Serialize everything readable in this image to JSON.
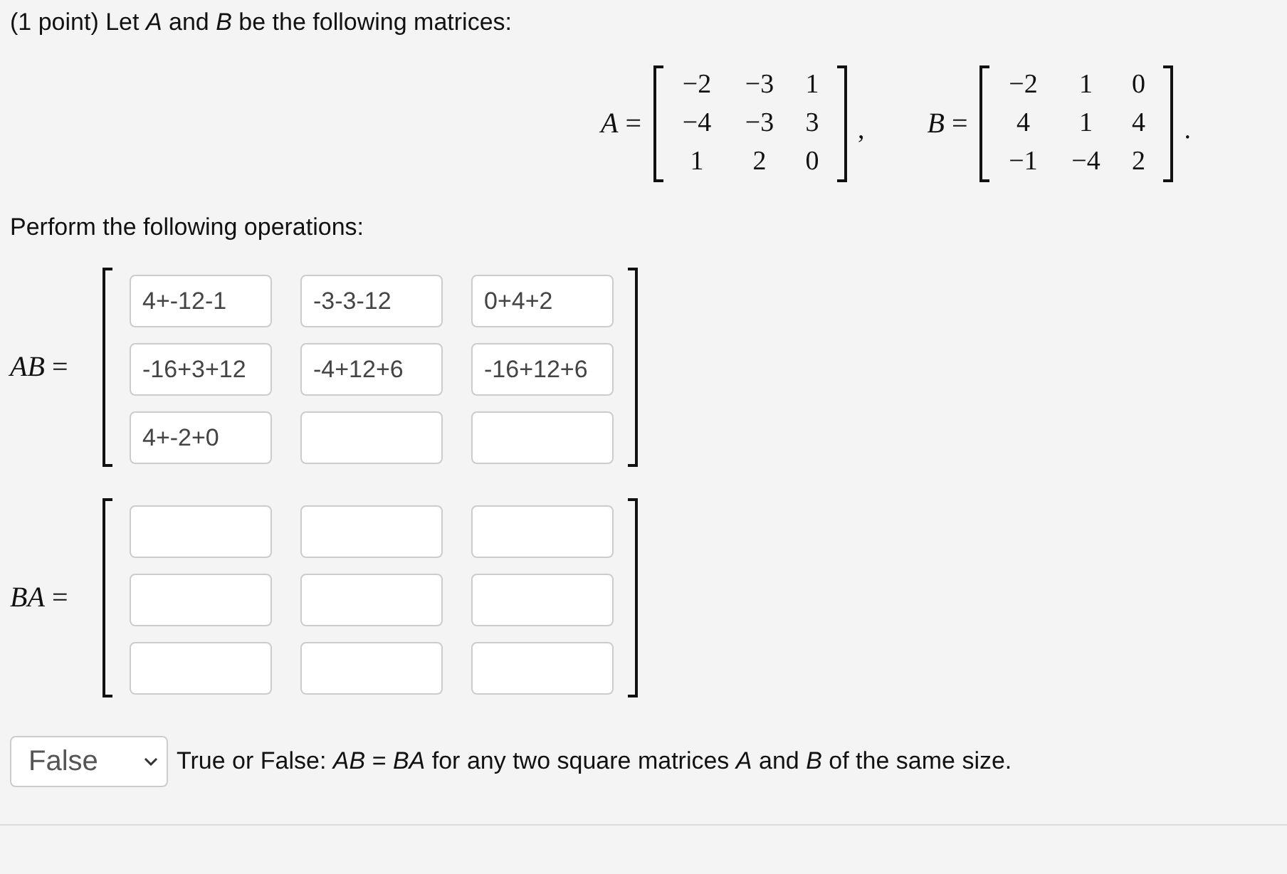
{
  "intro": "(1 point) Let *A* and *B* be the following matrices:",
  "given": [
    {
      "label": "*A* =",
      "rows": [
        [
          "−2",
          "−3",
          "1"
        ],
        [
          "−4",
          "−3",
          "3"
        ],
        [
          "1",
          "2",
          "0"
        ]
      ],
      "after": ","
    },
    {
      "label": "*B* =",
      "rows": [
        [
          "−2",
          "1",
          "0"
        ],
        [
          "4",
          "1",
          "4"
        ],
        [
          "−1",
          "−4",
          "2"
        ]
      ],
      "after": "."
    }
  ],
  "instruction": "Perform the following operations:",
  "answers": [
    {
      "label": "*AB* =",
      "cells": [
        [
          {
            "value": "4+-12-1"
          },
          {
            "value": "-3-3-12"
          },
          {
            "value": "0+4+2"
          }
        ],
        [
          {
            "value": "-16+3+12"
          },
          {
            "value": "-4+12+6"
          },
          {
            "value": "-16+12+6"
          }
        ],
        [
          {
            "value": "4+-2+0"
          },
          {},
          {}
        ]
      ]
    },
    {
      "label": "*BA* =",
      "cells": [
        [
          {},
          {},
          {}
        ],
        [
          {},
          {},
          {}
        ],
        [
          {},
          {},
          {}
        ]
      ]
    }
  ],
  "true_false": {
    "value": "False",
    "statement": "True or False: *AB* = *BA* for any two square matrices *A* and *B* of the same size."
  }
}
